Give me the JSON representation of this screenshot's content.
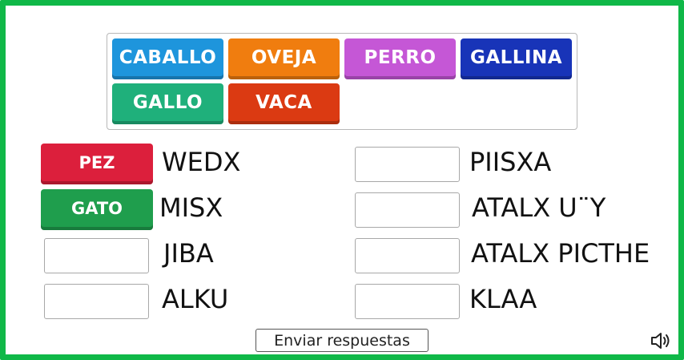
{
  "bank_tiles": [
    {
      "label": "CABALLO",
      "color": "#1e95dc"
    },
    {
      "label": "OVEJA",
      "color": "#f07d0f"
    },
    {
      "label": "PERRO",
      "color": "#c557d6"
    },
    {
      "label": "GALLINA",
      "color": "#1834b8"
    },
    {
      "label": "GALLO",
      "color": "#1fb07b"
    },
    {
      "label": "VACA",
      "color": "#db3a12"
    }
  ],
  "left_items": [
    {
      "word": "WEDX",
      "answer": "PEZ",
      "answer_color": "#dc1f3c"
    },
    {
      "word": "MISX",
      "answer": "GATO",
      "answer_color": "#1f9e4d"
    },
    {
      "word": "JIBA",
      "answer": ""
    },
    {
      "word": "ALKU",
      "answer": ""
    }
  ],
  "right_items": [
    {
      "word": "PIISXA",
      "answer": ""
    },
    {
      "word": "ATALX U¨Y",
      "answer": ""
    },
    {
      "word": "ATALX PICTHE",
      "answer": ""
    },
    {
      "word": "KLAA",
      "answer": ""
    }
  ],
  "submit_label": "Enviar respuestas",
  "icons": {
    "sound": "speaker-icon"
  },
  "accent_border": "#10b848"
}
